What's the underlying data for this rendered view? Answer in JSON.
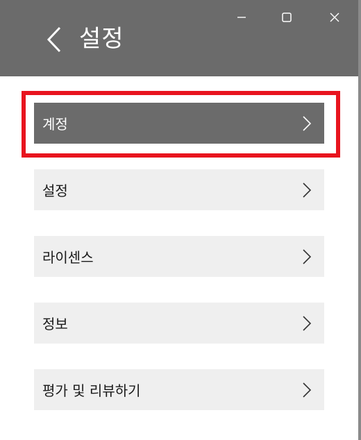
{
  "header": {
    "title": "설정",
    "back_icon": "chevron-left-icon"
  },
  "window_controls": {
    "minimize_icon": "minimize-icon",
    "maximize_icon": "maximize-icon",
    "close_icon": "close-icon"
  },
  "menu": {
    "items": [
      {
        "label": "계정",
        "selected": true
      },
      {
        "label": "설정",
        "selected": false
      },
      {
        "label": "라이센스",
        "selected": false
      },
      {
        "label": "정보",
        "selected": false
      },
      {
        "label": "평가 및 리뷰하기",
        "selected": false
      }
    ]
  },
  "colors": {
    "header_bg": "#6b6b6b",
    "item_bg": "#efefef",
    "selected_item_bg": "#6b6b6b",
    "highlight_border": "#e8141e",
    "text": "#1a1a1a"
  }
}
